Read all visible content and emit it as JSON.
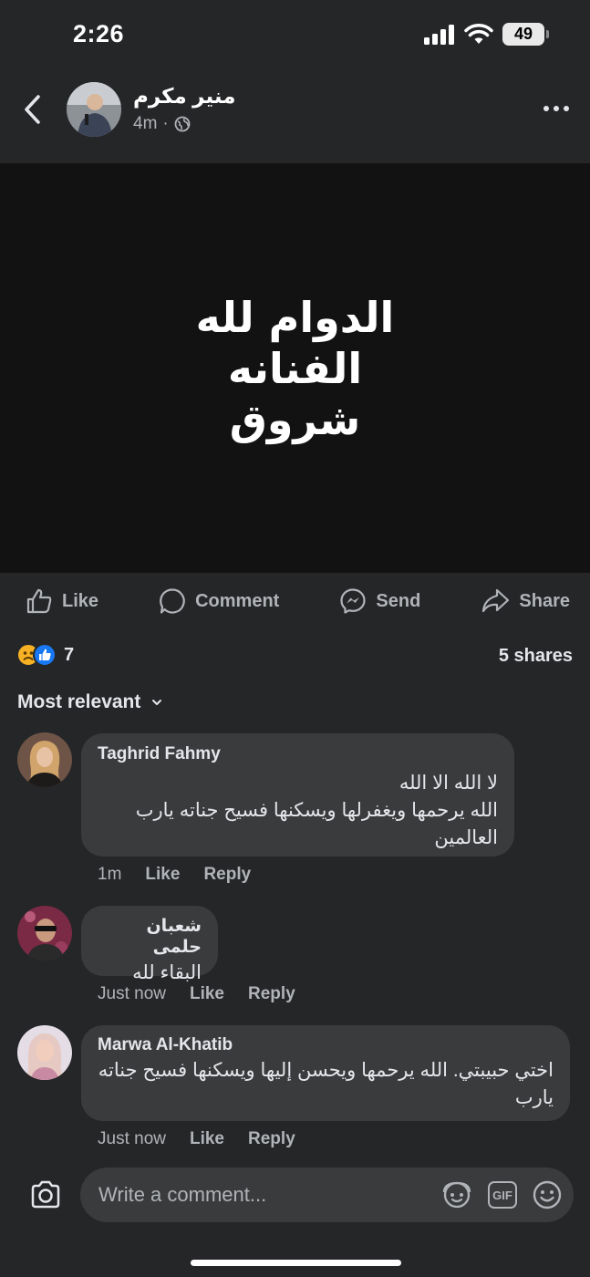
{
  "status_bar": {
    "time": "2:26",
    "battery": "49"
  },
  "post": {
    "author": "منير مكرم",
    "time": "4m",
    "separator": "·",
    "image_text": "الدوام لله\nالفنانه\nشروق"
  },
  "actions": {
    "like": "Like",
    "comment": "Comment",
    "send": "Send",
    "share": "Share"
  },
  "stats": {
    "reaction_count": "7",
    "shares": "5 shares"
  },
  "sort_label": "Most relevant",
  "comments": [
    {
      "name": "Taghrid Fahmy",
      "text": "لا الله الا الله\nالله يرحمها ويغفرلها ويسكنها فسيح جناته يارب العالمين",
      "time": "1m",
      "like": "Like",
      "reply": "Reply"
    },
    {
      "name": "شعبان حلمى",
      "text": "البقاء لله",
      "time": "Just now",
      "like": "Like",
      "reply": "Reply"
    },
    {
      "name": "Marwa Al-Khatib",
      "text": "اختي حبيبتي. الله يرحمها ويحسن إليها ويسكنها فسيح جناته يارب",
      "time": "Just now",
      "like": "Like",
      "reply": "Reply"
    }
  ],
  "composer": {
    "placeholder": "Write a comment..."
  },
  "colors": {
    "background": "#252628",
    "bubble": "#3a3b3c",
    "like_blue": "#1877f2",
    "muted": "#b0b3b8"
  }
}
